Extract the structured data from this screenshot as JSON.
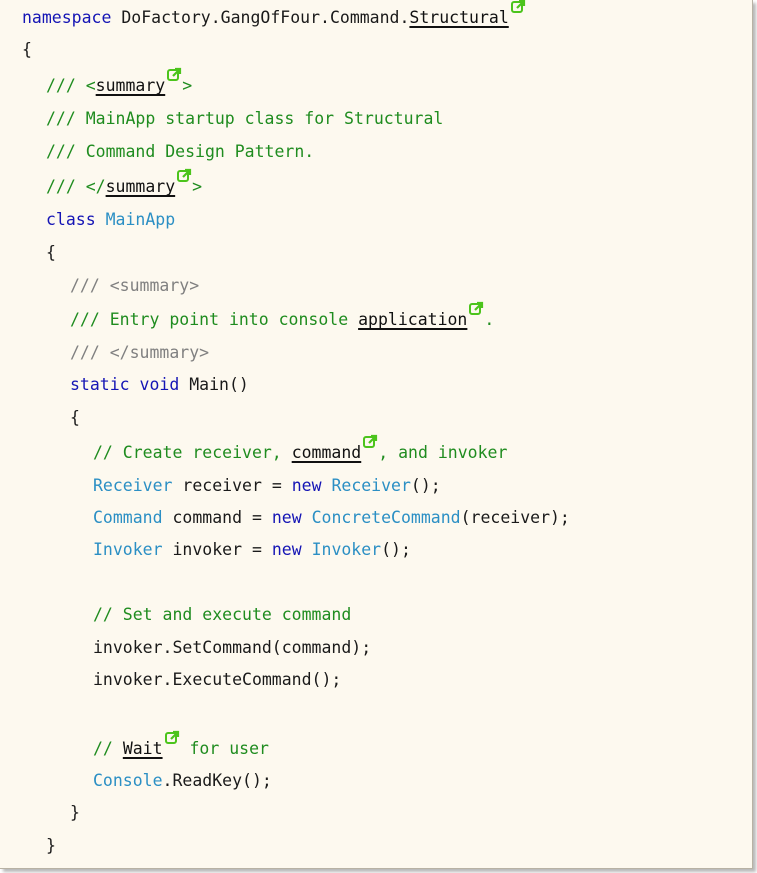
{
  "colors": {
    "keyword": "#1515b5",
    "type": "#2b8fc4",
    "comment": "#1f8c1f",
    "doc_tag": "#808080",
    "background": "#fdf9ef",
    "ext_link_icon": "#4cc41c"
  },
  "code": {
    "l1": {
      "kw": "namespace",
      "text": " DoFactory.GangOfFour.Command.",
      "link": "Structural"
    },
    "l2": {
      "text": "{"
    },
    "l3": {
      "pre": "/// <",
      "link": "summary",
      "post": ">"
    },
    "l4": {
      "text": "/// MainApp startup class for Structural"
    },
    "l5": {
      "text": "/// Command Design Pattern."
    },
    "l6": {
      "pre": "/// </",
      "link": "summary",
      "post": ">"
    },
    "l7": {
      "kw": "class",
      "type": " MainApp"
    },
    "l8": {
      "text": "{"
    },
    "l9": {
      "text": "/// <summary>"
    },
    "l10": {
      "pre": "/// Entry point into console ",
      "link": "application",
      "post": "."
    },
    "l11": {
      "text": "/// </summary>"
    },
    "l12": {
      "kw": "static void",
      "text": " Main()"
    },
    "l13": {
      "text": "{"
    },
    "l14": {
      "pre": "// Create receiver, ",
      "link": "command",
      "post": ", and invoker"
    },
    "l15": {
      "t1": "Receiver",
      "a": " receiver = ",
      "k": "new",
      "t2": " Receiver",
      "b": "();"
    },
    "l16": {
      "t1": "Command",
      "a": " command = ",
      "k": "new",
      "t2": " ConcreteCommand",
      "b": "(receiver);"
    },
    "l17": {
      "t1": "Invoker",
      "a": " invoker = ",
      "k": "new",
      "t2": " Invoker",
      "b": "();"
    },
    "l18": {
      "text": "// Set and execute command"
    },
    "l19": {
      "text": "invoker.SetCommand(command);"
    },
    "l20": {
      "text": "invoker.ExecuteCommand();"
    },
    "l21": {
      "pre": "// ",
      "link": "Wait",
      "post": " for user"
    },
    "l22": {
      "type": "Console",
      "text": ".ReadKey();"
    },
    "l23": {
      "text": "}"
    },
    "l24": {
      "text": "}"
    }
  }
}
